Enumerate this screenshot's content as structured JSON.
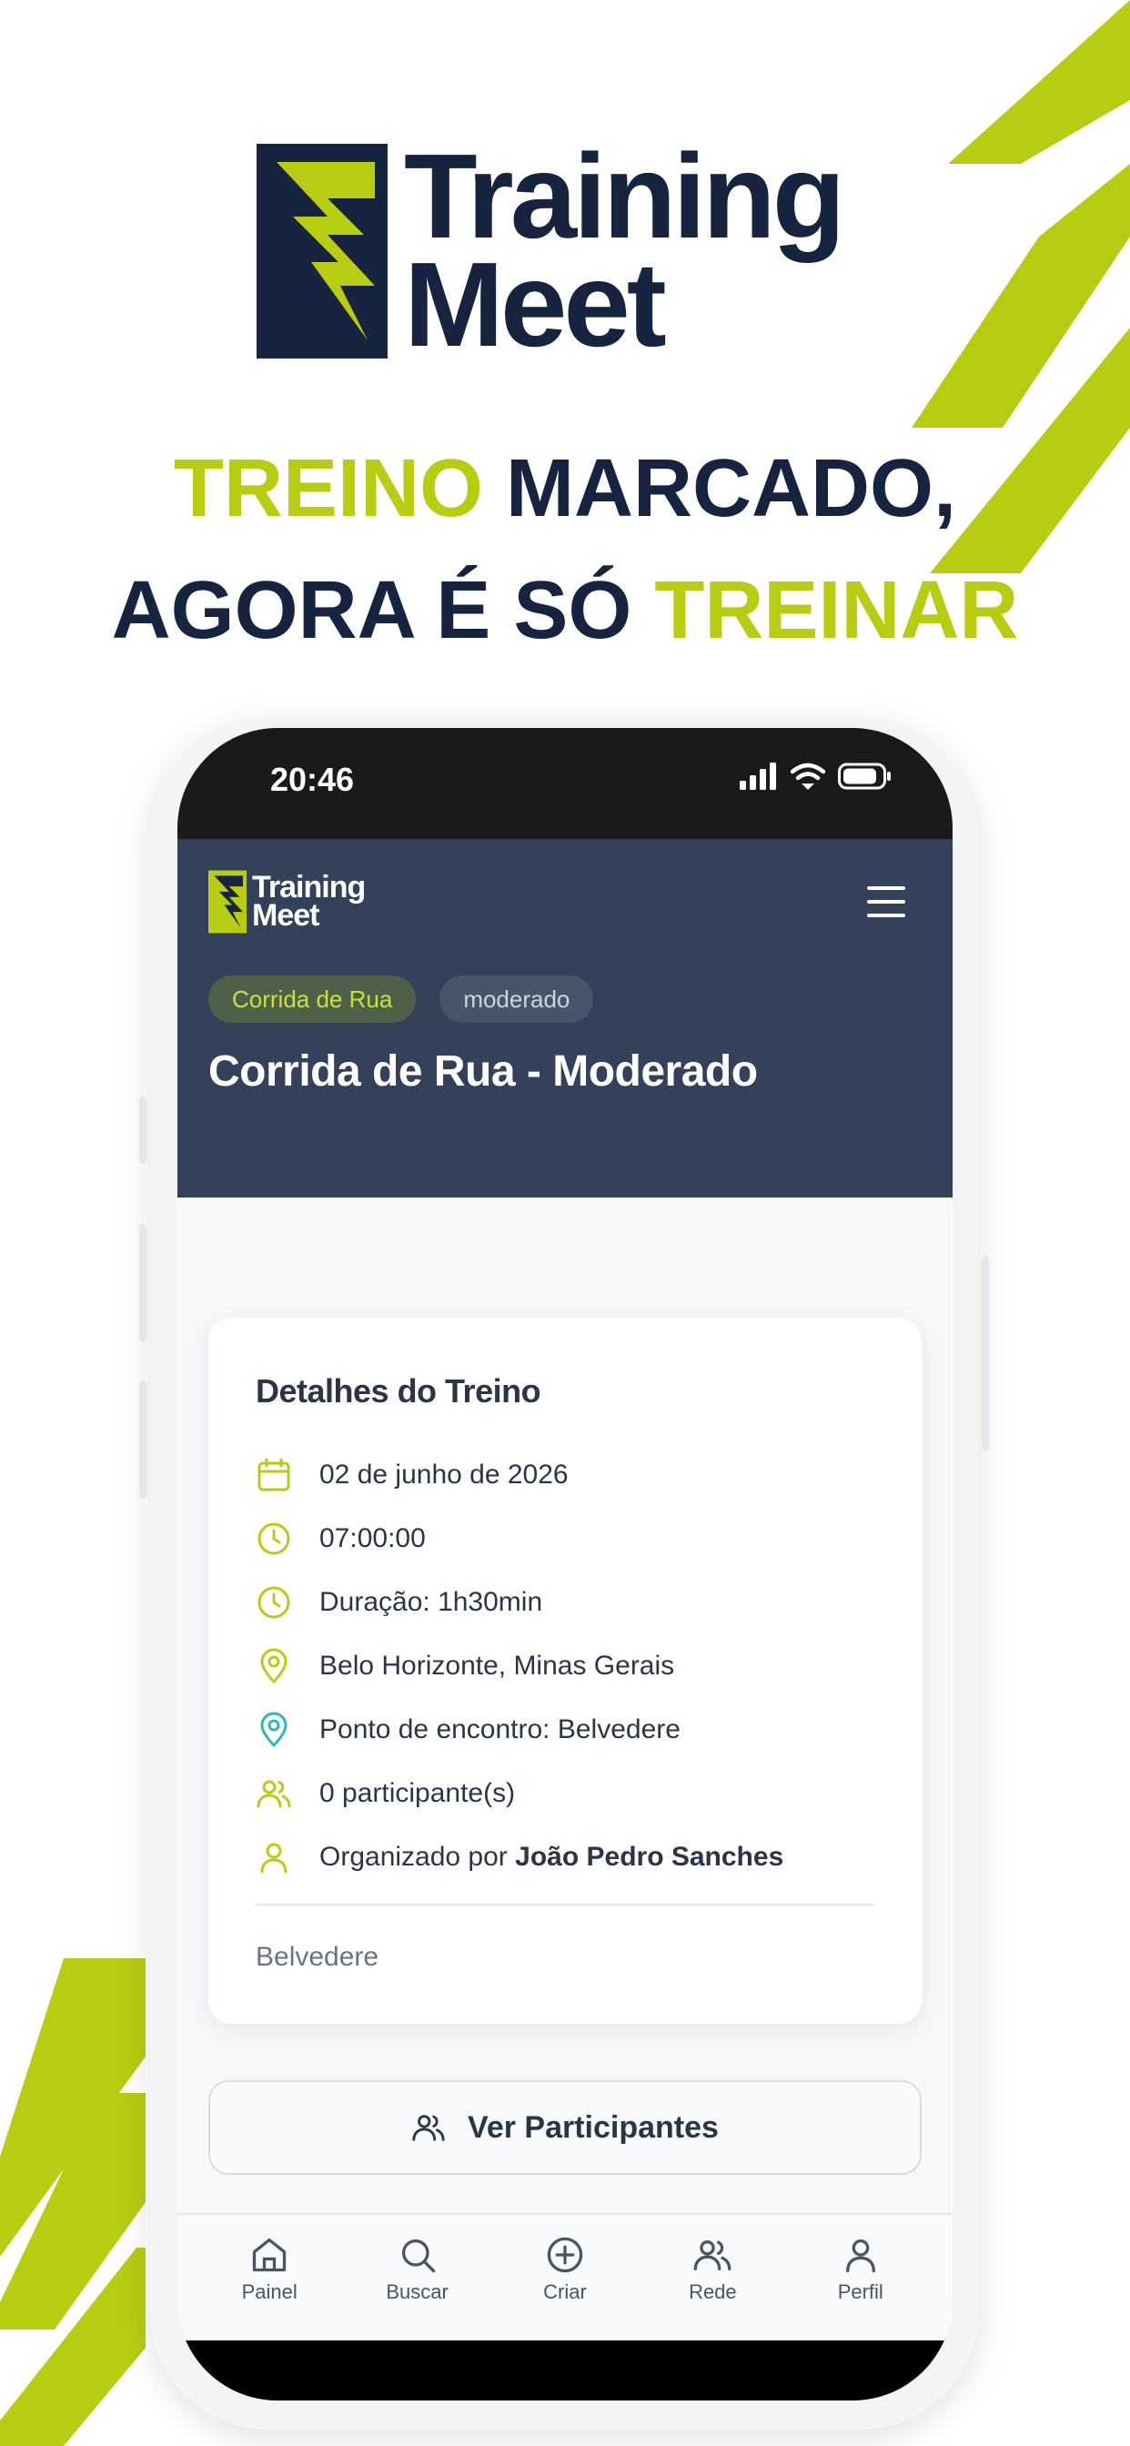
{
  "brand": {
    "line1": "Training",
    "line2": "Meet"
  },
  "headline": {
    "line1_accent": "TREINO",
    "line1_rest": " MARCADO,",
    "line2_rest": "AGORA É SÓ ",
    "line2_accent": "TREINAR"
  },
  "colors": {
    "accent": "#b8cc12",
    "navy": "#16243f",
    "header_bg": "#33425a"
  },
  "status": {
    "time": "20:46"
  },
  "app": {
    "logo": {
      "line1": "Training",
      "line2": "Meet"
    },
    "badges": {
      "category": "Corrida de Rua",
      "level": "moderado"
    },
    "title": "Corrida de Rua - Moderado"
  },
  "details": {
    "title": "Detalhes do Treino",
    "date": "02 de junho de 2026",
    "time": "07:00:00",
    "duration": "Duração: 1h30min",
    "city": "Belo Horizonte, Minas Gerais",
    "meeting_point": "Ponto de encontro: Belvedere",
    "participants": "0 participante(s)",
    "organizer_prefix": "Organizado por ",
    "organizer_name": "João Pedro Sanches",
    "footer": "Belvedere"
  },
  "actions": {
    "view_participants": "Ver Participantes"
  },
  "tabs": [
    {
      "label": "Painel",
      "icon": "home-icon"
    },
    {
      "label": "Buscar",
      "icon": "search-icon"
    },
    {
      "label": "Criar",
      "icon": "plus-circle-icon"
    },
    {
      "label": "Rede",
      "icon": "users-icon"
    },
    {
      "label": "Perfil",
      "icon": "user-icon"
    }
  ]
}
